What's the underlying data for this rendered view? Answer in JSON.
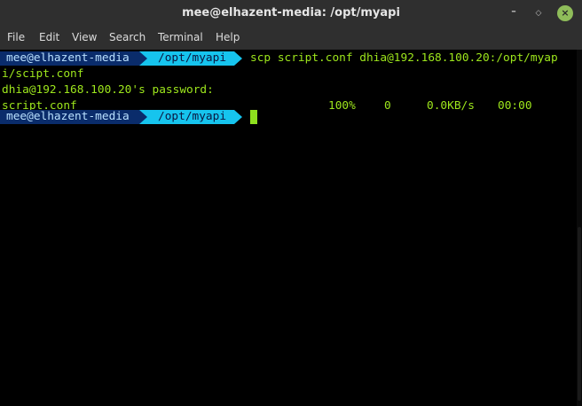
{
  "window": {
    "title": "mee@elhazent-media: /opt/myapi",
    "minimize_glyph": "–",
    "maximize_glyph": "◇",
    "close_glyph": "×",
    "close_color": "#8fbd5a"
  },
  "menu": {
    "file": "File",
    "edit": "Edit",
    "view": "View",
    "search": "Search",
    "terminal": "Terminal",
    "help": "Help"
  },
  "prompt": {
    "user_host": "mee@elhazent-media",
    "path": "/opt/myapi",
    "user_bg": "#0a2c6b",
    "path_bg": "#16c4ee"
  },
  "terminal": {
    "command": "scp script.conf dhia@192.168.100.20:/opt/myap",
    "command_wrap": "i/scipt.conf",
    "password_prompt": "dhia@192.168.100.20's password:",
    "transfer": {
      "file": "script.conf",
      "percent": "100%",
      "bytes": "0",
      "rate": "0.0KB/s",
      "eta": "00:00"
    },
    "text_color": "#9de61c"
  }
}
